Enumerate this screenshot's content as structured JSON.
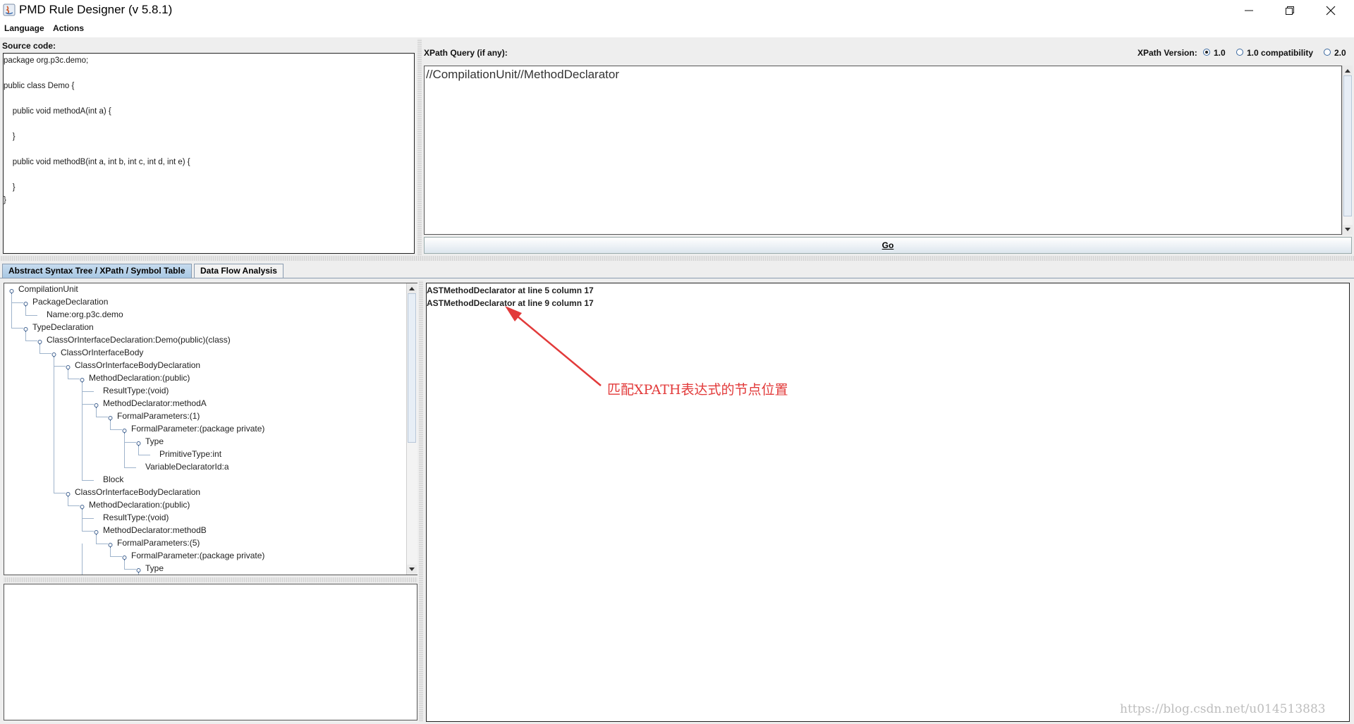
{
  "window": {
    "title": "PMD Rule Designer (v 5.8.1)",
    "minimize_icon": "minimize-icon",
    "maximize_icon": "restore-icon",
    "close_icon": "close-icon"
  },
  "menu": {
    "items": [
      "Language",
      "Actions"
    ]
  },
  "source": {
    "label": "Source code:",
    "lines": [
      "package org.p3c.demo;",
      "",
      "public class Demo {",
      "",
      "    public void methodA(int a) {",
      "",
      "    }",
      "",
      "    public void methodB(int a, int b, int c, int d, int e) {",
      "",
      "    }",
      "}"
    ]
  },
  "xpath": {
    "label": "XPath Query (if any):",
    "query": "//CompilationUnit//MethodDeclarator",
    "version_label": "XPath Version:",
    "versions": [
      {
        "label": "1.0",
        "selected": true
      },
      {
        "label": "1.0 compatibility",
        "selected": false
      },
      {
        "label": "2.0",
        "selected": false
      }
    ],
    "go_label": "Go"
  },
  "tabs": [
    {
      "label": "Abstract Syntax Tree / XPath / Symbol Table",
      "active": true
    },
    {
      "label": "Data Flow Analysis",
      "active": false
    }
  ],
  "tree": {
    "nodes": [
      {
        "label": "CompilationUnit",
        "depth": 0,
        "expandable": true
      },
      {
        "label": "PackageDeclaration",
        "depth": 1,
        "expandable": true
      },
      {
        "label": "Name:org.p3c.demo",
        "depth": 2,
        "expandable": false
      },
      {
        "label": "TypeDeclaration",
        "depth": 1,
        "expandable": true
      },
      {
        "label": "ClassOrInterfaceDeclaration:Demo(public)(class)",
        "depth": 2,
        "expandable": true
      },
      {
        "label": "ClassOrInterfaceBody",
        "depth": 3,
        "expandable": true
      },
      {
        "label": "ClassOrInterfaceBodyDeclaration",
        "depth": 4,
        "expandable": true
      },
      {
        "label": "MethodDeclaration:(public)",
        "depth": 5,
        "expandable": true
      },
      {
        "label": "ResultType:(void)",
        "depth": 6,
        "expandable": false
      },
      {
        "label": "MethodDeclarator:methodA",
        "depth": 6,
        "expandable": true
      },
      {
        "label": "FormalParameters:(1)",
        "depth": 7,
        "expandable": true
      },
      {
        "label": "FormalParameter:(package private)",
        "depth": 8,
        "expandable": true
      },
      {
        "label": "Type",
        "depth": 9,
        "expandable": true
      },
      {
        "label": "PrimitiveType:int",
        "depth": 10,
        "expandable": false
      },
      {
        "label": "VariableDeclaratorId:a",
        "depth": 9,
        "expandable": false
      },
      {
        "label": "Block",
        "depth": 6,
        "expandable": false
      },
      {
        "label": "ClassOrInterfaceBodyDeclaration",
        "depth": 4,
        "expandable": true
      },
      {
        "label": "MethodDeclaration:(public)",
        "depth": 5,
        "expandable": true
      },
      {
        "label": "ResultType:(void)",
        "depth": 6,
        "expandable": false
      },
      {
        "label": "MethodDeclarator:methodB",
        "depth": 6,
        "expandable": true
      },
      {
        "label": "FormalParameters:(5)",
        "depth": 7,
        "expandable": true
      },
      {
        "label": "FormalParameter:(package private)",
        "depth": 8,
        "expandable": true
      },
      {
        "label": "Type",
        "depth": 9,
        "expandable": true
      }
    ]
  },
  "results": {
    "lines": [
      "ASTMethodDeclarator at line 5 column 17",
      "ASTMethodDeclarator at line 9 column 17"
    ]
  },
  "annotation": {
    "text": "匹配XPATH表达式的节点位置",
    "color": "#e23a3a"
  },
  "watermark": "https://blog.csdn.net/u014513883"
}
